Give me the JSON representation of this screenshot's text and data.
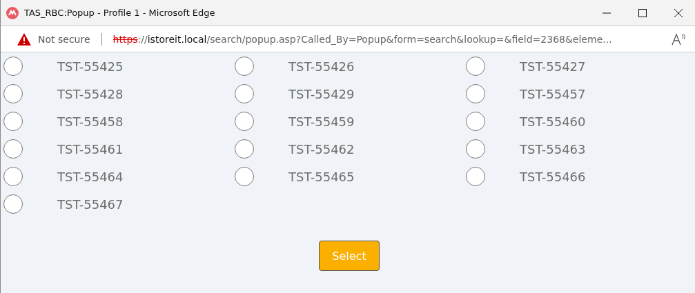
{
  "window": {
    "title": "TAS_RBC:Popup - Profile 1 - Microsoft Edge"
  },
  "address_bar": {
    "security": "Not secure",
    "url": {
      "scheme": "https",
      "separator": "://",
      "host": "istoreit.local",
      "path": "/search/popup.asp?Called_By=Popup&form=search&lookup=&field=2368&eleme..."
    }
  },
  "options": [
    {
      "label": "TST-55425",
      "selected": false
    },
    {
      "label": "TST-55426",
      "selected": false
    },
    {
      "label": "TST-55427",
      "selected": false
    },
    {
      "label": "TST-55428",
      "selected": false
    },
    {
      "label": "TST-55429",
      "selected": false
    },
    {
      "label": "TST-55457",
      "selected": false
    },
    {
      "label": "TST-55458",
      "selected": false
    },
    {
      "label": "TST-55459",
      "selected": false
    },
    {
      "label": "TST-55460",
      "selected": false
    },
    {
      "label": "TST-55461",
      "selected": false
    },
    {
      "label": "TST-55462",
      "selected": false
    },
    {
      "label": "TST-55463",
      "selected": false
    },
    {
      "label": "TST-55464",
      "selected": false
    },
    {
      "label": "TST-55465",
      "selected": false
    },
    {
      "label": "TST-55466",
      "selected": false
    },
    {
      "label": "TST-55467",
      "selected": false
    }
  ],
  "buttons": [
    "Select"
  ]
}
